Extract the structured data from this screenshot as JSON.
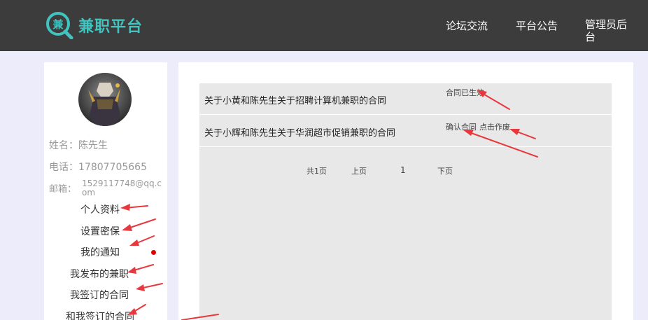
{
  "header": {
    "logo_glyph": "兼",
    "logo_text": "兼职平台",
    "nav": {
      "forum": "论坛交流",
      "notice": "平台公告",
      "admin": "管理员后台"
    }
  },
  "profile": {
    "name_line": "姓名：陈先生",
    "phone_line": "电话：17807705665",
    "email_label": "邮箱：",
    "email_value": "1529117748@qq.com"
  },
  "menu": [
    "个人资料",
    "设置密保",
    "我的通知",
    "我发布的兼职",
    "我签订的合同",
    "和我签订的合同"
  ],
  "contracts": [
    {
      "title": "关于小黄和陈先生关于招聘计算机兼职的合同",
      "status": "合同已生效"
    },
    {
      "title": "关于小辉和陈先生关于华润超市促销兼职的合同",
      "actions": [
        "确认合同",
        "点击作废"
      ]
    }
  ],
  "pager": {
    "total": "共1页",
    "prev": "上页",
    "current": "1",
    "next": "下页"
  },
  "colors": {
    "header_bg": "#3c3c3c",
    "brand": "#3fc4c0",
    "page_bg": "#ececfb",
    "annotation": "#e8383d",
    "notify_dot": "#e00000"
  }
}
